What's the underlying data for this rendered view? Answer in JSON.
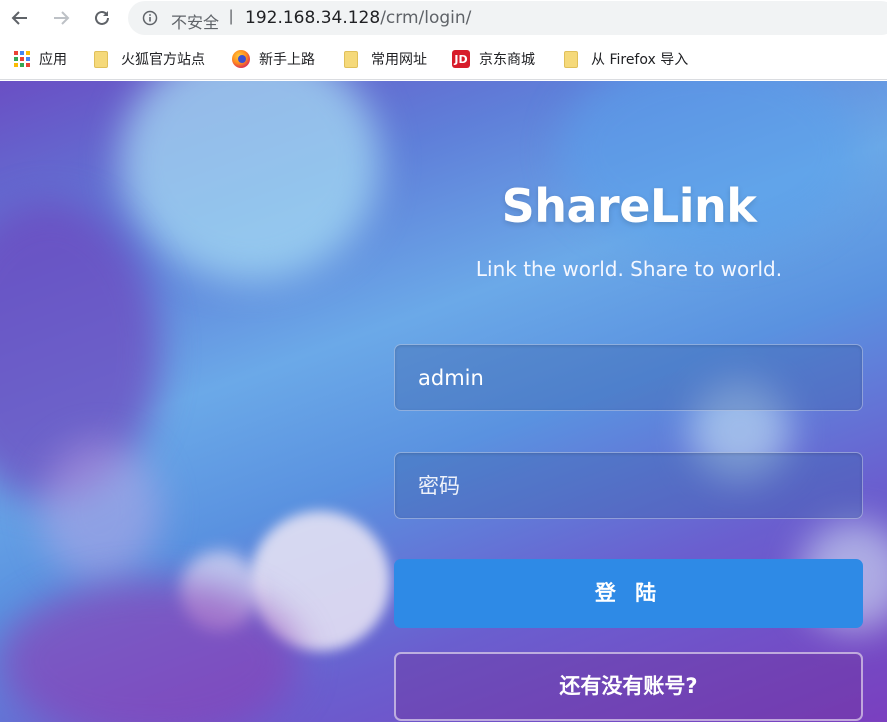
{
  "browser": {
    "security_label": "不安全",
    "separator": "|",
    "url_host": "192.168.34.128",
    "url_path": "/crm/login/",
    "bookmarks": [
      {
        "label": "应用",
        "icon": "apps-grid-icon"
      },
      {
        "label": "火狐官方站点",
        "icon": "folder-icon"
      },
      {
        "label": "新手上路",
        "icon": "firefox-icon"
      },
      {
        "label": "常用网址",
        "icon": "folder-icon"
      },
      {
        "label": "京东商城",
        "icon": "jd-icon",
        "icon_text": "JD"
      },
      {
        "label": "从 Firefox 导入",
        "icon": "folder-icon"
      }
    ]
  },
  "login": {
    "title": "ShareLink",
    "subtitle": "Link the world. Share to world.",
    "username_value": "admin",
    "password_placeholder": "密码",
    "login_button": "登 陆",
    "register_link": "还有没有账号?"
  },
  "colors": {
    "login_button": "#2e8ae6",
    "background_primary": "#6ba9e8",
    "background_secondary": "#7a3fbf"
  }
}
